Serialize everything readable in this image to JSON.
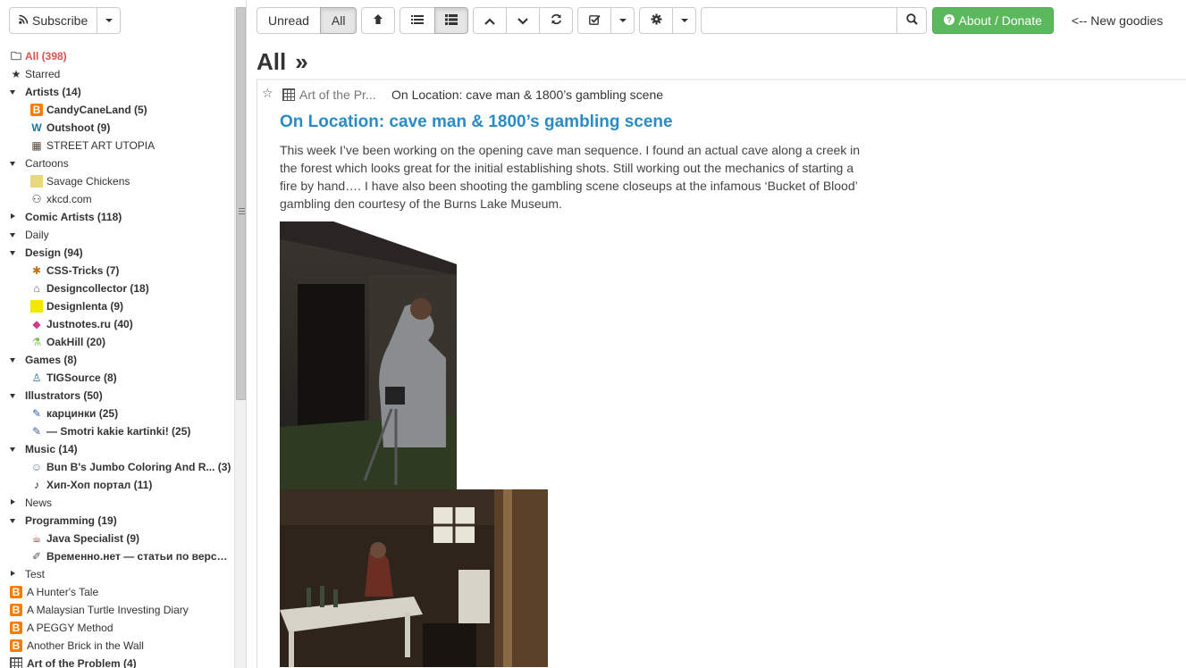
{
  "sidebar": {
    "subscribe_label": "Subscribe",
    "tree": [
      {
        "type": "top",
        "icon": "inbox-icon",
        "glyph": "🗀",
        "label": "All (398)",
        "selected": true
      },
      {
        "type": "top",
        "icon": "star-icon",
        "glyph": "★",
        "label": "Starred"
      },
      {
        "type": "cat",
        "open": true,
        "label": "Artists (14)",
        "bold": true
      },
      {
        "type": "feed",
        "lvl": 1,
        "icon": "blogger-icon",
        "glyph": "B",
        "label": "CandyCaneLand (5)",
        "bold": true
      },
      {
        "type": "feed",
        "lvl": 1,
        "icon": "wordpress-icon",
        "glyph": "W",
        "label": "Outshoot (9)",
        "bold": true
      },
      {
        "type": "feed",
        "lvl": 1,
        "icon": "photo-icon",
        "glyph": "▦",
        "label": "STREET ART UTOPIA"
      },
      {
        "type": "cat",
        "open": true,
        "label": "Cartoons"
      },
      {
        "type": "feed",
        "lvl": 1,
        "icon": "note-icon",
        "glyph": "▭",
        "label": "Savage Chickens"
      },
      {
        "type": "feed",
        "lvl": 1,
        "icon": "xkcd-icon",
        "glyph": "⚇",
        "label": "xkcd.com"
      },
      {
        "type": "cat",
        "open": false,
        "label": "Comic Artists (118)",
        "bold": true
      },
      {
        "type": "cat",
        "open": true,
        "label": "Daily"
      },
      {
        "type": "cat",
        "open": true,
        "label": "Design (94)",
        "bold": true
      },
      {
        "type": "feed",
        "lvl": 1,
        "icon": "asterisk-icon",
        "glyph": "✱",
        "label": "CSS-Tricks (7)",
        "bold": true
      },
      {
        "type": "feed",
        "lvl": 1,
        "icon": "lock-icon",
        "glyph": "⌂",
        "label": "Designcollector (18)",
        "bold": true
      },
      {
        "type": "feed",
        "lvl": 1,
        "icon": "yellow-square-icon",
        "glyph": "■",
        "label": "Designlenta (9)",
        "bold": true
      },
      {
        "type": "feed",
        "lvl": 1,
        "icon": "gem-icon",
        "glyph": "◆",
        "label": "Justnotes.ru (40)",
        "bold": true
      },
      {
        "type": "feed",
        "lvl": 1,
        "icon": "flask-icon",
        "glyph": "⚗",
        "label": "OakHill (20)",
        "bold": true
      },
      {
        "type": "cat",
        "open": true,
        "label": "Games (8)",
        "bold": true
      },
      {
        "type": "feed",
        "lvl": 1,
        "icon": "tig-icon",
        "glyph": "♙",
        "label": "TIGSource (8)",
        "bold": true
      },
      {
        "type": "cat",
        "open": true,
        "label": "Illustrators (50)",
        "bold": true
      },
      {
        "type": "feed",
        "lvl": 1,
        "icon": "pencil-icon",
        "glyph": "✎",
        "label": "карцинки (25)",
        "bold": true
      },
      {
        "type": "feed",
        "lvl": 1,
        "icon": "pencil-icon",
        "glyph": "✎",
        "label": "— Smotri kakie kartinki! (25)",
        "bold": true
      },
      {
        "type": "cat",
        "open": true,
        "label": "Music (14)",
        "bold": true
      },
      {
        "type": "feed",
        "lvl": 1,
        "icon": "face-icon",
        "glyph": "☺",
        "label": "Bun B's Jumbo Coloring And R... (3)",
        "bold": true
      },
      {
        "type": "feed",
        "lvl": 1,
        "icon": "microphone-icon",
        "glyph": "♪",
        "label": "Хип-Хоп портал (11)",
        "bold": true
      },
      {
        "type": "cat",
        "open": false,
        "label": "News"
      },
      {
        "type": "cat",
        "open": true,
        "label": "Programming (19)",
        "bold": true
      },
      {
        "type": "feed",
        "lvl": 1,
        "icon": "java-icon",
        "glyph": "☕",
        "label": "Java Specialist (9)",
        "bold": true
      },
      {
        "type": "feed",
        "lvl": 1,
        "icon": "clip-icon",
        "glyph": "✐",
        "label": "Временно.нет — статьи по верстке...",
        "bold": true
      },
      {
        "type": "cat",
        "open": false,
        "label": "Test"
      },
      {
        "type": "feed",
        "lvl": 0,
        "icon": "blogger-icon",
        "glyph": "B",
        "label": "A Hunter's Tale"
      },
      {
        "type": "feed",
        "lvl": 0,
        "icon": "blogger-icon",
        "glyph": "B",
        "label": "A Malaysian Turtle Investing Diary"
      },
      {
        "type": "feed",
        "lvl": 0,
        "icon": "blogger-icon",
        "glyph": "B",
        "label": "A PEGGY Method"
      },
      {
        "type": "feed",
        "lvl": 0,
        "icon": "blogger-icon",
        "glyph": "B",
        "label": "Another Brick in the Wall"
      },
      {
        "type": "feed",
        "lvl": 0,
        "icon": "grid-icon",
        "glyph": "",
        "label": "Art of the Problem (4)",
        "bold": true
      }
    ]
  },
  "toolbar": {
    "unread_label": "Unread",
    "all_label": "All",
    "about_label": "About / Donate",
    "search_value": "",
    "search_placeholder": "",
    "new_goodies": "<-- New goodies"
  },
  "main": {
    "page_title": "All",
    "page_title_arrow": "»",
    "entry": {
      "feed_name": "Art of the Pr...",
      "title_small": "On Location: cave man & 1800’s gambling scene",
      "title": "On Location: cave man & 1800’s gambling scene",
      "body": "This week I’ve been working on the opening cave man sequence. I found an actual cave along a creek in the forest which looks great for the initial establishing shots. Still working out the mechanics of starting a fire by hand…. I have also been shooting the gambling scene closeups at the infamous ‘Bucket of Blood’ gambling den courtesy of the Burns Lake Museum."
    }
  },
  "colors": {
    "link": "#2a8cc4",
    "selected": "#d9534f",
    "success": "#5cb85c",
    "blogger": "#f57d00"
  }
}
